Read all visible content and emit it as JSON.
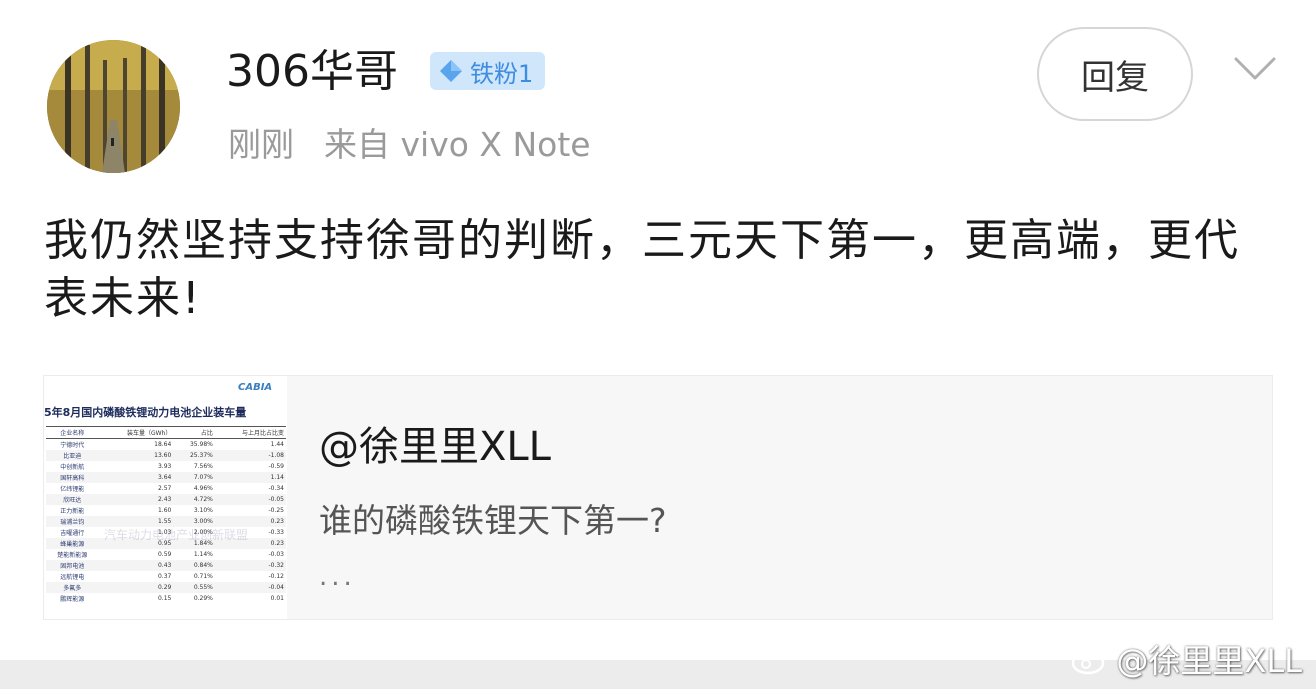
{
  "user": {
    "name": "306华哥",
    "badge": "铁粉1",
    "time": "刚刚",
    "source": "来自 vivo X Note"
  },
  "actions": {
    "reply_label": "回复"
  },
  "post": {
    "text": "我仍然坚持支持徐哥的判断，三元天下第一，更高端，更代表未来!"
  },
  "quoted": {
    "author": "@徐里里XLL",
    "text": "谁的磷酸铁锂天下第一?",
    "more": "...",
    "thumbnail": {
      "logo": "CABIA",
      "title": "5年8月国内磷酸铁锂动力电池企业装车量",
      "columns": [
        "企业名称",
        "装车量（GWh）",
        "占比",
        "与上月比占比变"
      ],
      "rows": [
        [
          "宁德时代",
          "18.64",
          "35.98%",
          "1.44"
        ],
        [
          "比亚迪",
          "13.60",
          "25.37%",
          "-1.08"
        ],
        [
          "中创新航",
          "3.93",
          "7.56%",
          "-0.59"
        ],
        [
          "国轩高科",
          "3.64",
          "7.07%",
          "1.14"
        ],
        [
          "亿纬锂能",
          "2.57",
          "4.96%",
          "-0.34"
        ],
        [
          "欣旺达",
          "2.43",
          "4.72%",
          "-0.05"
        ],
        [
          "正力新能",
          "1.60",
          "3.10%",
          "-0.25"
        ],
        [
          "瑞浦兰钧",
          "1.55",
          "3.00%",
          "0.23"
        ],
        [
          "吉曜通行",
          "1.03",
          "2.00%",
          "-0.33"
        ],
        [
          "蜂巢能源",
          "0.95",
          "1.84%",
          "0.23"
        ],
        [
          "楚能新能源",
          "0.59",
          "1.14%",
          "-0.03"
        ],
        [
          "固邦电池",
          "0.43",
          "0.84%",
          "-0.32"
        ],
        [
          "远航锂电",
          "0.37",
          "0.71%",
          "-0.12"
        ],
        [
          "多氟多",
          "0.29",
          "0.55%",
          "-0.04"
        ],
        [
          "鹏辉能源",
          "0.15",
          "0.29%",
          "0.01"
        ]
      ],
      "watermark": "汽车动力电池产业创新联盟"
    }
  },
  "watermark": {
    "text": "@徐里里XLL"
  },
  "colors": {
    "badge_bg": "#cfe6fb",
    "badge_text": "#3f8de0",
    "meta_text": "#9a9a9a",
    "card_bg": "#f7f7f7"
  },
  "icons": [
    "diamond-icon",
    "chevron-down-icon",
    "weibo-icon"
  ]
}
